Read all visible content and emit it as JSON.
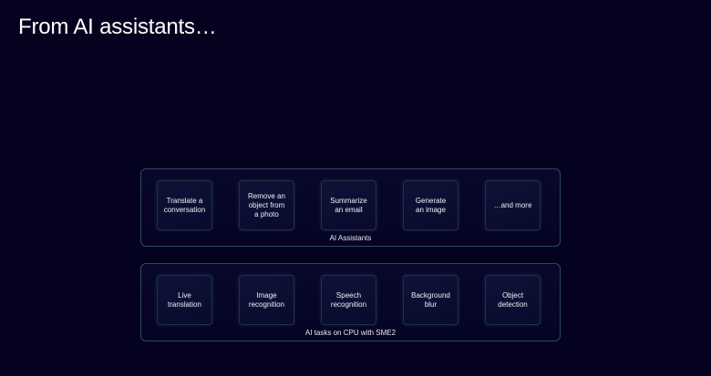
{
  "title": "From AI assistants…",
  "groups": [
    {
      "label": "AI Assistants",
      "items": [
        "Translate a\nconversation",
        "Remove an\nobject from\na photo",
        "Summarize\nan email",
        "Generate\nan image",
        "…and more"
      ]
    },
    {
      "label": "AI tasks on CPU with SME2",
      "items": [
        "Live\ntranslation",
        "Image\nrecognition",
        "Speech\nrecognition",
        "Background\nblur",
        "Object\ndetection"
      ]
    }
  ]
}
